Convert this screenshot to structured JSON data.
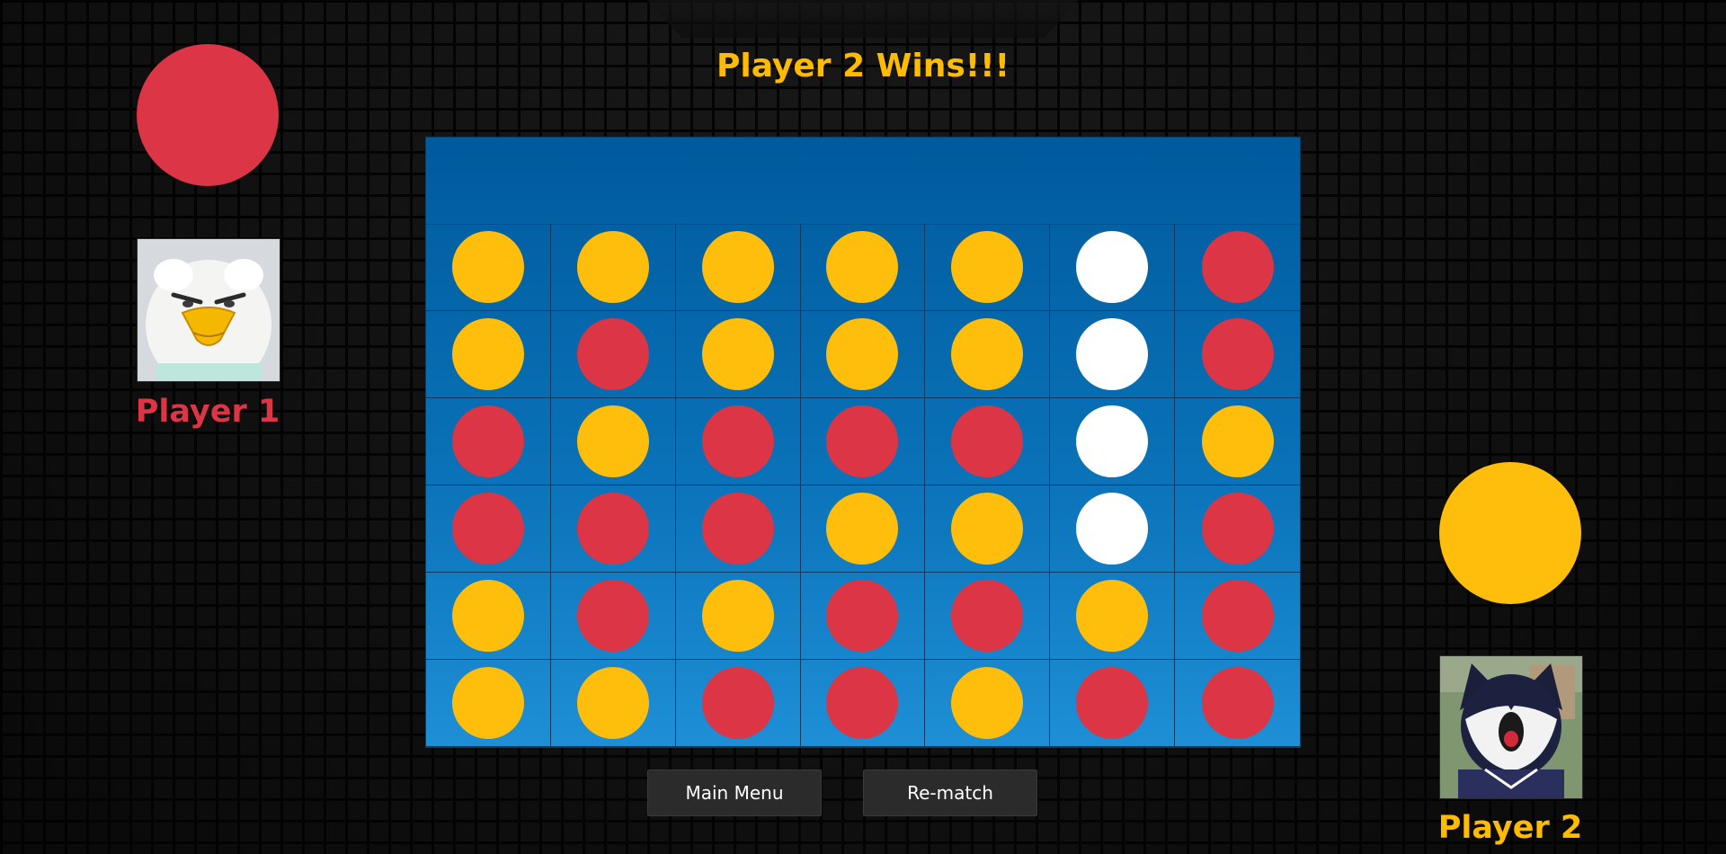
{
  "status": {
    "text": "Player 2 Wins!!!"
  },
  "players": [
    {
      "name": "Player 1",
      "color": "#dc3545",
      "avatar_icon": "eagle-mascot-icon"
    },
    {
      "name": "Player 2",
      "color": "#ffbe0b",
      "avatar_icon": "husky-mascot-icon"
    }
  ],
  "board": {
    "rows": 6,
    "columns": 7,
    "cells": [
      [
        "yellow",
        "yellow",
        "yellow",
        "yellow",
        "yellow",
        "white",
        "red"
      ],
      [
        "yellow",
        "red",
        "yellow",
        "yellow",
        "yellow",
        "white",
        "red"
      ],
      [
        "red",
        "yellow",
        "red",
        "red",
        "red",
        "white",
        "yellow"
      ],
      [
        "red",
        "red",
        "red",
        "yellow",
        "yellow",
        "white",
        "red"
      ],
      [
        "yellow",
        "red",
        "yellow",
        "red",
        "red",
        "yellow",
        "red"
      ],
      [
        "yellow",
        "yellow",
        "red",
        "red",
        "yellow",
        "red",
        "red"
      ]
    ],
    "colors": {
      "red": "#dc3545",
      "yellow": "#ffbe0b",
      "white": "#ffffff",
      "board": "#0a72b8"
    }
  },
  "buttons": {
    "main_menu": "Main Menu",
    "rematch": "Re-match"
  }
}
